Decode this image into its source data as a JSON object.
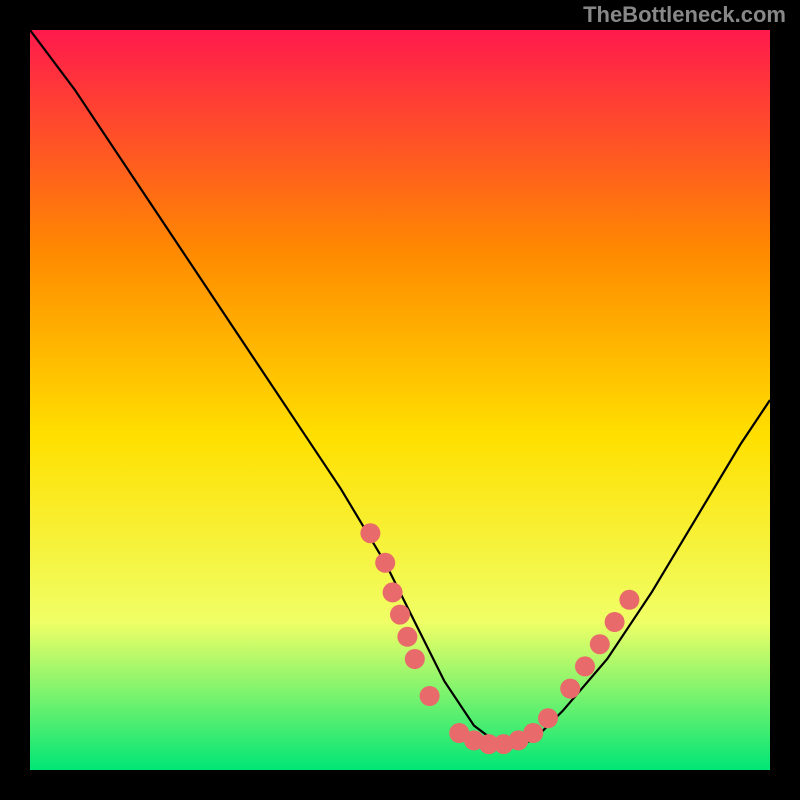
{
  "watermark": "TheBottleneck.com",
  "chart_data": {
    "type": "line",
    "title": "",
    "xlabel": "",
    "ylabel": "",
    "xlim": [
      0,
      100
    ],
    "ylim": [
      0,
      100
    ],
    "background_gradient": {
      "top": "#ff1a4d",
      "upper_mid": "#ff8a00",
      "mid": "#ffe000",
      "lower_mid": "#f0ff66",
      "bottom": "#00e676"
    },
    "curve": {
      "name": "bottleneck-curve",
      "x": [
        0,
        6,
        12,
        18,
        24,
        30,
        36,
        42,
        48,
        52,
        56,
        60,
        64,
        68,
        72,
        78,
        84,
        90,
        96,
        100
      ],
      "y": [
        100,
        92,
        83,
        74,
        65,
        56,
        47,
        38,
        28,
        20,
        12,
        6,
        3,
        4,
        8,
        15,
        24,
        34,
        44,
        50
      ]
    },
    "markers": {
      "color": "#e86a6a",
      "points": [
        {
          "x": 46,
          "y": 32
        },
        {
          "x": 48,
          "y": 28
        },
        {
          "x": 49,
          "y": 24
        },
        {
          "x": 50,
          "y": 21
        },
        {
          "x": 51,
          "y": 18
        },
        {
          "x": 52,
          "y": 15
        },
        {
          "x": 54,
          "y": 10
        },
        {
          "x": 58,
          "y": 5
        },
        {
          "x": 60,
          "y": 4
        },
        {
          "x": 62,
          "y": 3.5
        },
        {
          "x": 64,
          "y": 3.5
        },
        {
          "x": 66,
          "y": 4
        },
        {
          "x": 68,
          "y": 5
        },
        {
          "x": 70,
          "y": 7
        },
        {
          "x": 73,
          "y": 11
        },
        {
          "x": 75,
          "y": 14
        },
        {
          "x": 77,
          "y": 17
        },
        {
          "x": 79,
          "y": 20
        },
        {
          "x": 81,
          "y": 23
        }
      ]
    }
  }
}
